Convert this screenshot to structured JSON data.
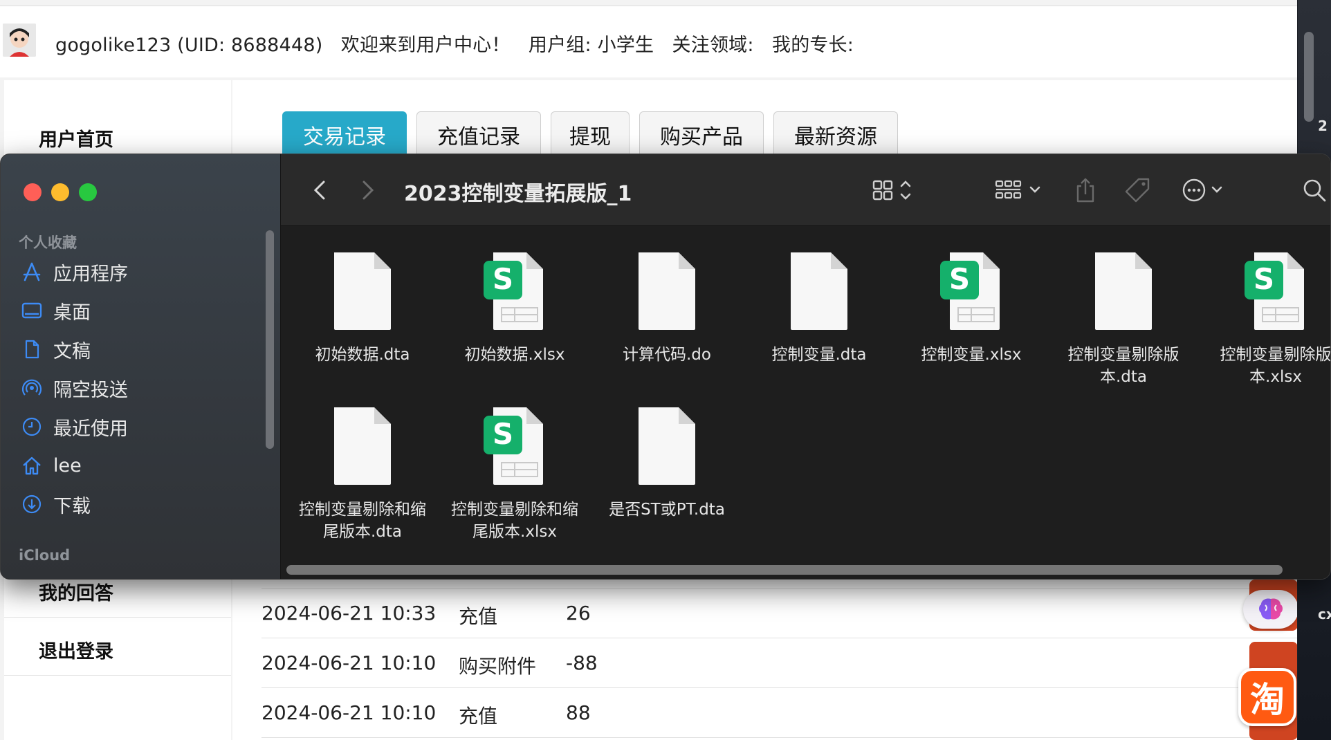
{
  "webpage": {
    "user_info": "gogolike123 (UID: 8688448)   欢迎来到用户中心！   用户组: 小学生   关注领域:   我的专长:",
    "sidebar": {
      "home": "用户首页",
      "my_answers": "我的回答",
      "logout": "退出登录"
    },
    "tabs": [
      "交易记录",
      "充值记录",
      "提现",
      "购买产品",
      "最新资源"
    ],
    "transactions": [
      {
        "time": "2024-06-21 10:33",
        "type": "充值",
        "amount": "26"
      },
      {
        "time": "2024-06-21 10:10",
        "type": "购买附件",
        "amount": "-88"
      },
      {
        "time": "2024-06-21 10:10",
        "type": "充值",
        "amount": "88"
      }
    ],
    "taobao_label": "淘",
    "accent_color": "#27a9c9"
  },
  "desktop": {
    "edge_chars": [
      "2",
      "cx"
    ]
  },
  "finder": {
    "title": "2023控制变量拓展版_1",
    "sidebar": {
      "favorites_header": "个人收藏",
      "items": [
        {
          "label": "应用程序",
          "icon": "applications-icon"
        },
        {
          "label": "桌面",
          "icon": "desktop-icon"
        },
        {
          "label": "文稿",
          "icon": "documents-icon"
        },
        {
          "label": "隔空投送",
          "icon": "airdrop-icon"
        },
        {
          "label": "最近使用",
          "icon": "recents-icon"
        },
        {
          "label": "lee",
          "icon": "home-icon"
        },
        {
          "label": "下载",
          "icon": "downloads-icon"
        }
      ],
      "icloud_header": "iCloud"
    },
    "files": [
      {
        "name": "初始数据.dta",
        "kind": "dta"
      },
      {
        "name": "初始数据.xlsx",
        "kind": "xlsx"
      },
      {
        "name": "计算代码.do",
        "kind": "do"
      },
      {
        "name": "控制变量.dta",
        "kind": "dta"
      },
      {
        "name": "控制变量.xlsx",
        "kind": "xlsx"
      },
      {
        "name": "控制变量剔除版本.dta",
        "kind": "dta"
      },
      {
        "name": "控制变量剔除版本.xlsx",
        "kind": "xlsx"
      },
      {
        "name": "控制变量剔除和缩尾版本.dta",
        "kind": "dta"
      },
      {
        "name": "控制变量剔除和缩尾版本.xlsx",
        "kind": "xlsx"
      },
      {
        "name": "是否ST或PT.dta",
        "kind": "dta"
      }
    ],
    "file_labels": {
      "f0": [
        "初始数据.dta"
      ],
      "f1": [
        "初始数据.xlsx"
      ],
      "f2": [
        "计算代码.do"
      ],
      "f3": [
        "控制变量.dta"
      ],
      "f4": [
        "控制变量.xlsx"
      ],
      "f5": [
        "控制变量剔除版",
        "本.dta"
      ],
      "f6": [
        "控制变量剔除版",
        "本.xlsx"
      ],
      "f7": [
        "控制变量剔除和缩",
        "尾版本.dta"
      ],
      "f8": [
        "控制变量剔除和缩",
        "尾版本.xlsx"
      ],
      "f9": [
        "是否ST或PT.dta"
      ]
    },
    "xlsx_icon_letter": "S",
    "colors": {
      "traffic_close": "#ff5f57",
      "traffic_min": "#febc2e",
      "traffic_max": "#28c840",
      "sidebar_icon": "#3d8bf5",
      "xlsx_green": "#15b06b"
    }
  }
}
